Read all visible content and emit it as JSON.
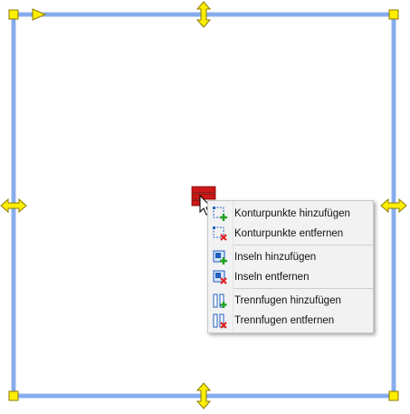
{
  "colors": {
    "frame": "#8fb2ee",
    "frame_edge": "#4a7fe0",
    "handle": "#ffee00",
    "handle_stroke": "#8a7a00",
    "accent_blue": "#1f5fbf",
    "add_green": "#20a020",
    "remove_red": "#e02020"
  },
  "handles": {
    "corner_icon": "square-handle-icon",
    "direction_icon": "direction-arrow-icon",
    "resize_v_icon": "resize-vertical-icon",
    "resize_h_icon": "resize-horizontal-icon"
  },
  "context_menu": {
    "items": [
      {
        "label": "Konturpunkte hinzufügen",
        "icon": "add-contour-point-icon"
      },
      {
        "label": "Konturpunkte entfernen",
        "icon": "remove-contour-point-icon"
      },
      {
        "label": "Inseln hinzufügen",
        "icon": "add-island-icon"
      },
      {
        "label": "Inseln entfernen",
        "icon": "remove-island-icon"
      },
      {
        "label": "Trennfugen hinzufügen",
        "icon": "add-joint-icon"
      },
      {
        "label": "Trennfugen entfernen",
        "icon": "remove-joint-icon"
      }
    ]
  }
}
